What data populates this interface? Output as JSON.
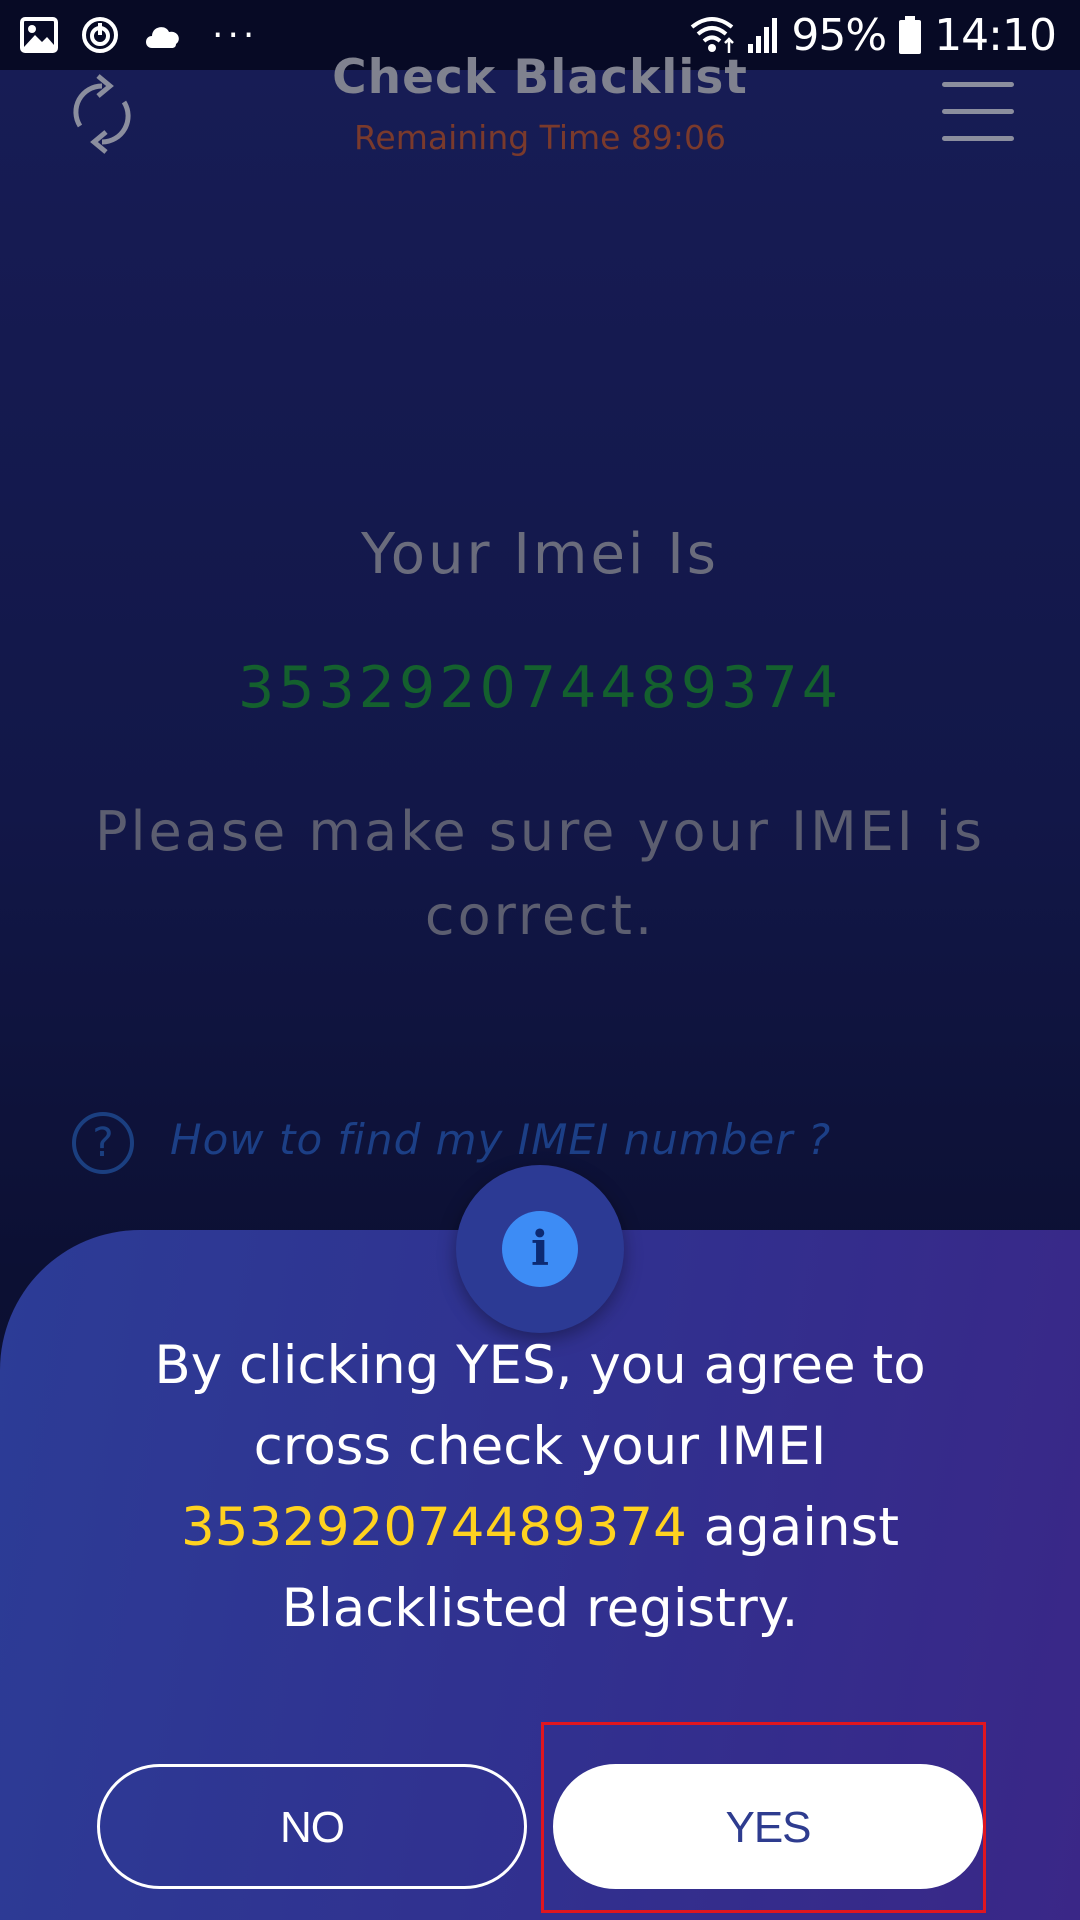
{
  "status_bar": {
    "icons_left": [
      "image-icon",
      "sync-icon",
      "cloud-icon"
    ],
    "more": "···",
    "battery": "95%",
    "time": "14:10"
  },
  "header": {
    "title": "Check Blacklist",
    "subtitle": "Remaining Time 89:06"
  },
  "main": {
    "imei_label": "Your Imei Is",
    "imei_value": "353292074489374",
    "note": "Please make sure your IMEI is correct.",
    "help_link": "How to find my IMEI number ?"
  },
  "dialog": {
    "info_symbol": "i",
    "message_before": "By clicking YES, you agree to cross check your IMEI ",
    "message_imei": "353292074489374",
    "message_after": " against Blacklisted registry.",
    "no_label": "NO",
    "yes_label": "YES"
  },
  "colors": {
    "imei_highlight": "#ffd21f",
    "annotation_box": "#e0161f"
  }
}
